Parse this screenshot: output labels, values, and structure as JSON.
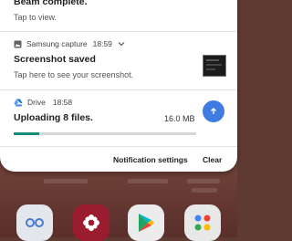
{
  "beam": {
    "title": "Beam complete.",
    "subtitle": "Tap to view."
  },
  "screenshot_notification": {
    "app_name": "Samsung capture",
    "time": "18:59",
    "title": "Screenshot saved",
    "text": "Tap here to see your screenshot."
  },
  "drive_notification": {
    "app_name": "Drive",
    "time": "18:58",
    "title": "Uploading 8 files.",
    "size": "16.0 MB",
    "progress": 0.14
  },
  "footer": {
    "settings_label": "Notification settings",
    "clear_label": "Clear"
  },
  "colors": {
    "drive_blue": "#1a73e8",
    "progress_fill": "#1a8a78",
    "progress_track": "#d6d6d6",
    "upload_button": "#3f7be0"
  }
}
